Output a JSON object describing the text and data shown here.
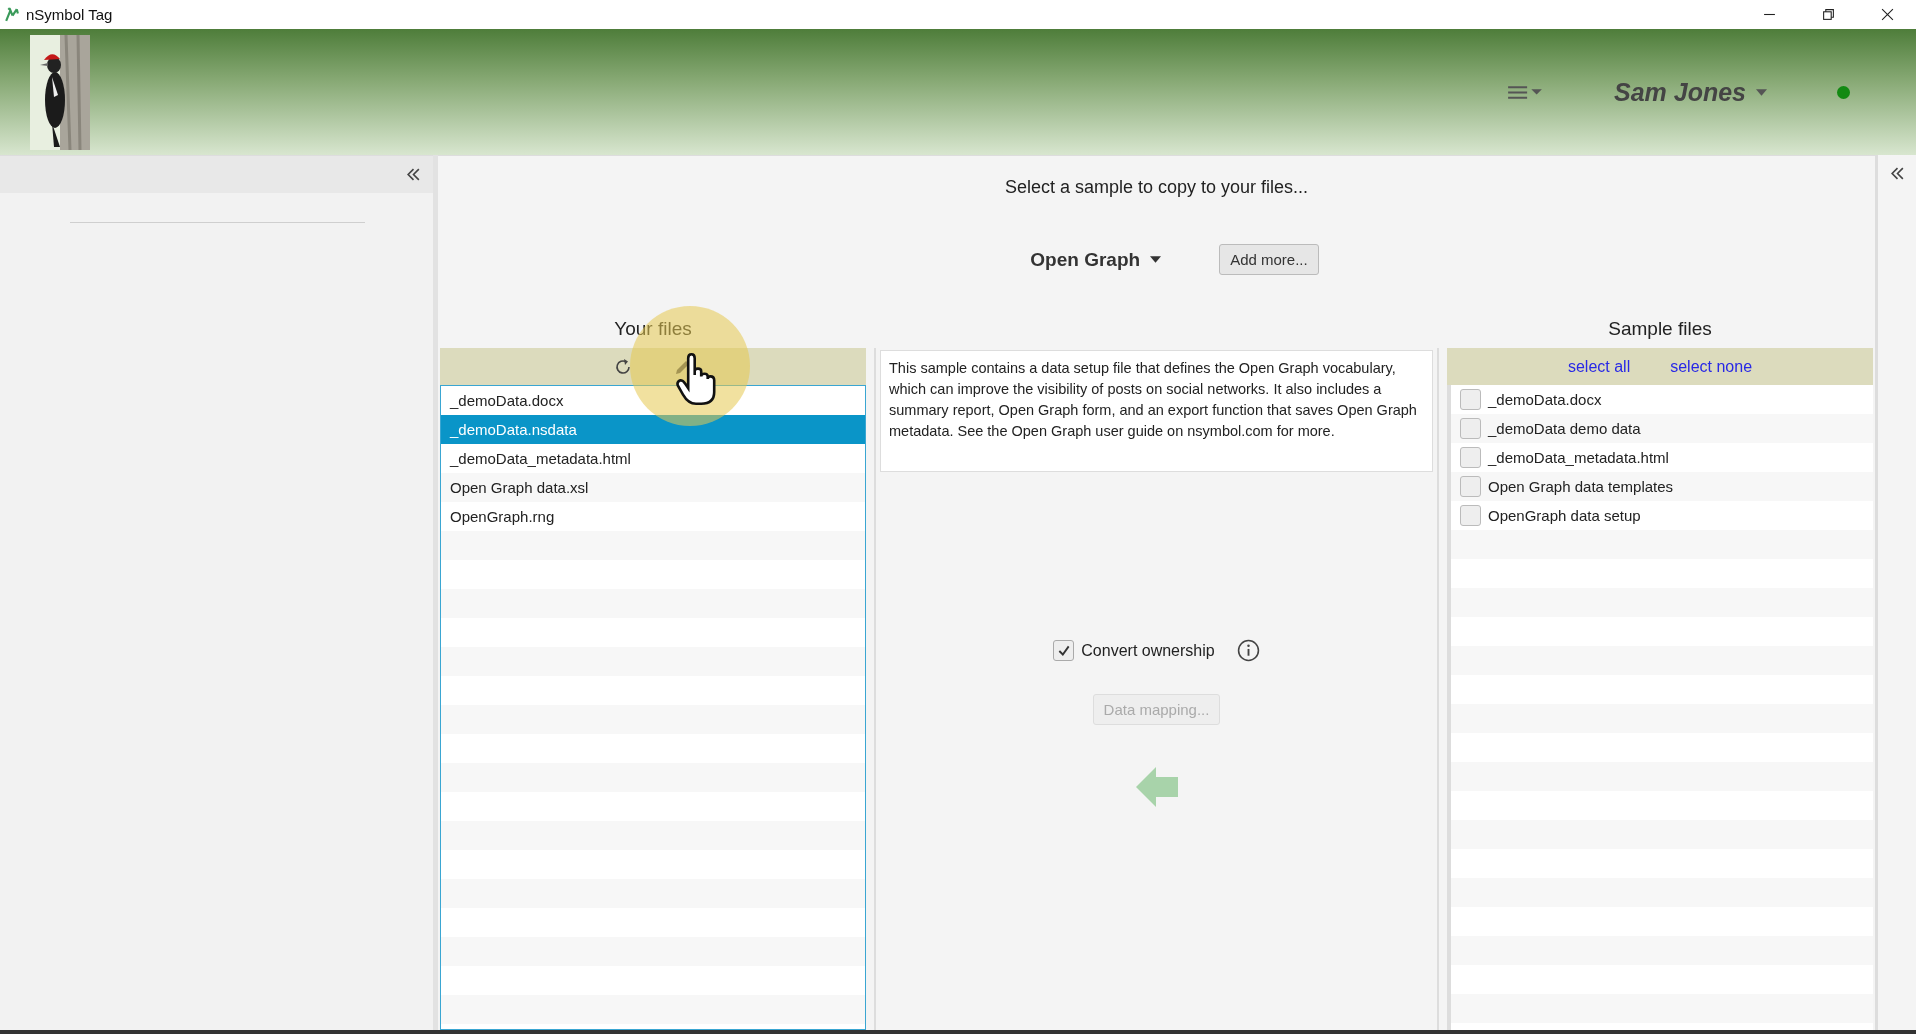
{
  "window": {
    "title": "nSymbol Tag"
  },
  "header": {
    "user": "Sam Jones",
    "online": true
  },
  "prompt": "Select a sample to copy to your files...",
  "sample_set": {
    "label": "Open Graph"
  },
  "add_button": "Add more...",
  "your_files": {
    "title": "Your files",
    "items": [
      {
        "name": "_demoData.docx",
        "selected": false
      },
      {
        "name": "_demoData.nsdata",
        "selected": true
      },
      {
        "name": "_demoData_metadata.html",
        "selected": false
      },
      {
        "name": "Open Graph data.xsl",
        "selected": false
      },
      {
        "name": "OpenGraph.rng",
        "selected": false
      }
    ]
  },
  "description": "This sample contains a data setup file that defines the Open Graph vocabulary, which can improve the visibility of posts on social networks. It also includes a summary report, Open Graph form, and an export function that saves Open Graph metadata. See the Open Graph user guide on nsymbol.com for more.",
  "convert_ownership": {
    "label": "Convert ownership",
    "checked": true
  },
  "data_mapping": {
    "label": "Data mapping...",
    "disabled": true
  },
  "sample_files": {
    "title": "Sample files",
    "select_all": "select all",
    "select_none": "select none",
    "items": [
      {
        "name": "_demoData.docx",
        "checked": false
      },
      {
        "name": "_demoData demo data",
        "checked": false
      },
      {
        "name": "_demoData_metadata.html",
        "checked": false
      },
      {
        "name": "Open Graph data templates",
        "checked": false
      },
      {
        "name": "OpenGraph data setup",
        "checked": false
      }
    ]
  }
}
